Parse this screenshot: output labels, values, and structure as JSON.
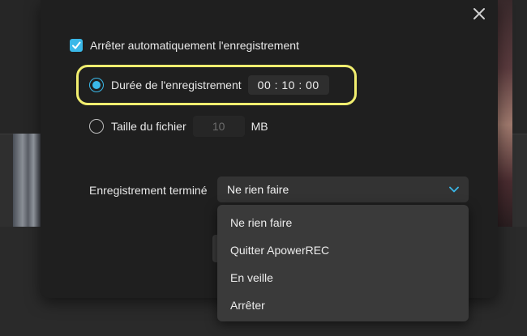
{
  "dialog": {
    "close_icon": "close-icon",
    "auto_stop": {
      "label": "Arrêter automatiquement l'enregistrement",
      "checked": true
    },
    "duration": {
      "label": "Durée de l'enregistrement",
      "value": "00 : 10 : 00",
      "selected": true
    },
    "file_size": {
      "label": "Taille du fichier",
      "value": "10",
      "unit": "MB",
      "selected": false
    },
    "on_finish": {
      "label": "Enregistrement terminé",
      "selected_value": "Ne rien faire",
      "options": [
        "Ne rien faire",
        "Quitter ApowerREC",
        "En veille",
        "Arrêter"
      ]
    }
  },
  "colors": {
    "accent": "#3ab8e8",
    "highlight": "#f1ee6f"
  }
}
